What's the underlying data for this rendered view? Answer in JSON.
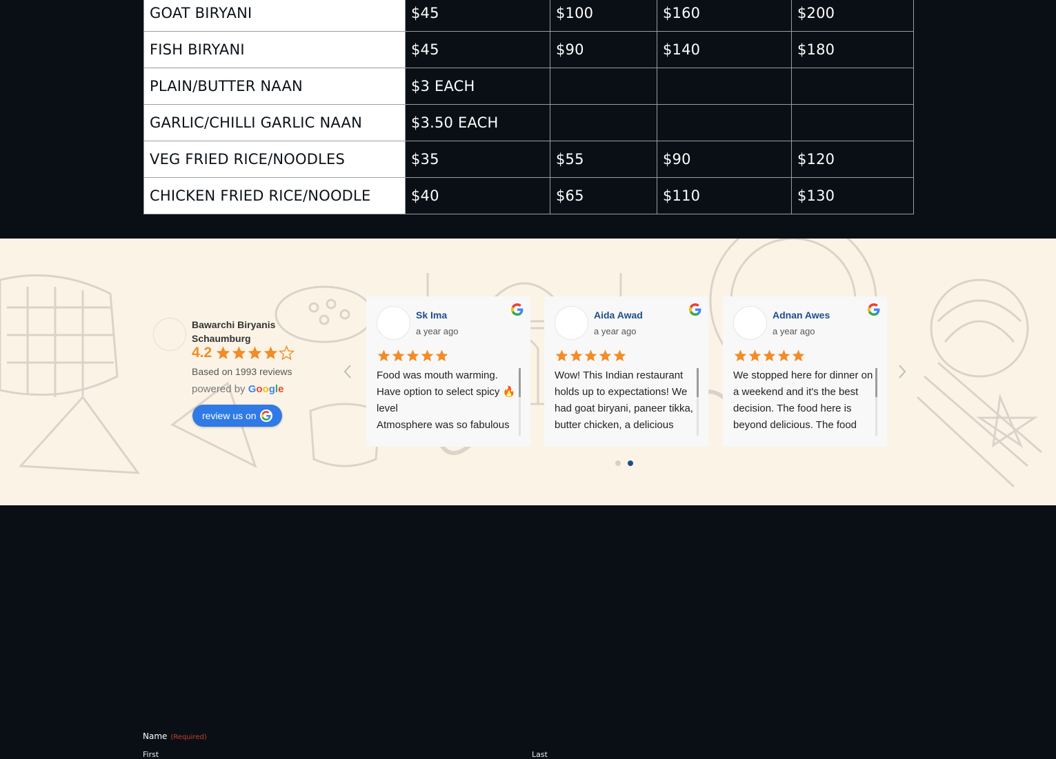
{
  "menu": {
    "rows": [
      {
        "item": "GOAT BIRYANI",
        "prices": [
          "$45",
          "$100",
          "$160",
          "$200"
        ]
      },
      {
        "item": "FISH BIRYANI",
        "prices": [
          "$45",
          "$90",
          "$140",
          "$180"
        ]
      },
      {
        "item": "PLAIN/BUTTER NAAN",
        "prices": [
          "$3 EACH",
          "",
          "",
          ""
        ]
      },
      {
        "item": "GARLIC/CHILLI GARLIC NAAN",
        "prices": [
          "$3.50 EACH",
          "",
          "",
          ""
        ]
      },
      {
        "item": "VEG FRIED RICE/NOODLES",
        "prices": [
          "$35",
          "$55",
          "$90",
          "$120"
        ]
      },
      {
        "item": "CHICKEN FRIED RICE/NOODLE",
        "prices": [
          "$40",
          "$65",
          "$110",
          "$130"
        ]
      }
    ]
  },
  "reviews": {
    "business_name": "Bawarchi Biryanis Schaumburg",
    "rating": "4.2",
    "rating_value": 4.2,
    "based_on": "Based on 1993 reviews",
    "powered_by": "powered by",
    "google_word": "Google",
    "review_button": "review us on",
    "cards": [
      {
        "name": "Sk Ima",
        "time": "a year ago",
        "stars": 5,
        "text": "Food was mouth warming.\nHave option to select spicy 🔥 level\nAtmosphere was so fabulous"
      },
      {
        "name": "Aida Awad",
        "time": "a year ago",
        "stars": 5,
        "text": "Wow! This Indian restaurant holds up to expectations! We had goat biryani, paneer tikka, butter chicken, a delicious"
      },
      {
        "name": "Adnan Awes",
        "time": "a year ago",
        "stars": 5,
        "text": "We stopped here for dinner on a weekend and it's the best decision. The food here is beyond delicious. The food"
      }
    ],
    "carousel_dots": 2,
    "active_dot": 1
  },
  "form": {
    "name_label": "Name",
    "required_label": "(Required)",
    "first_label": "First",
    "last_label": "Last"
  },
  "colors": {
    "accent_star": "#f28c28",
    "reviewer_name": "#1e4d8c",
    "button_blue": "#2f7ae5",
    "page_bg": "#0a0f15",
    "band_bg": "#fbf4e6",
    "required_red": "#c7412f"
  },
  "icons": [
    "star-icon",
    "google-g-icon",
    "chevron-left-icon",
    "chevron-right-icon"
  ]
}
